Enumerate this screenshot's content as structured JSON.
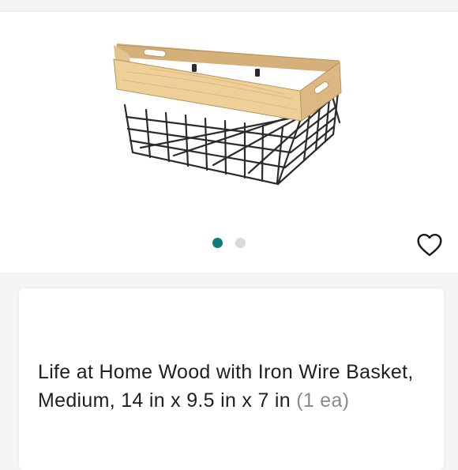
{
  "product": {
    "name": "Life at Home Wood with Iron Wire Basket, Medium, 14 in x 9.5 in x 7 in",
    "quantity": "(1 ea)"
  },
  "gallery": {
    "image_count": 2,
    "active_index": 0,
    "image_alt": "wood-and-iron-wire-basket"
  },
  "favorite": {
    "icon": "heart-outline-icon",
    "selected": false
  },
  "colors": {
    "accent": "#0b7e7a",
    "dot_inactive": "#d9d9d9",
    "text": "#1f1f1f",
    "muted_text": "#8a8a8a"
  }
}
